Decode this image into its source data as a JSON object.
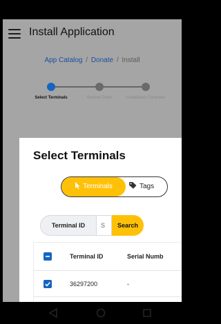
{
  "app": {
    "title": "Install Application"
  },
  "breadcrumb": {
    "items": [
      "App Catalog",
      "Donate",
      "Install"
    ],
    "separator": "/"
  },
  "stepper": {
    "steps": [
      {
        "label": "Select Terminals",
        "state": "active"
      },
      {
        "label": "Review Order",
        "state": "pending"
      },
      {
        "label": "Installation Complete",
        "state": "pending"
      }
    ]
  },
  "modal": {
    "title": "Select Terminals",
    "toggle": {
      "options": [
        {
          "label": "Terminals",
          "icon": "pointer-icon",
          "selected": true
        },
        {
          "label": "Tags",
          "icon": "tag-icon",
          "selected": false
        }
      ]
    },
    "search": {
      "field_label": "Terminal ID",
      "input_value": "S",
      "button_label": "Search"
    },
    "table": {
      "columns": [
        "Terminal ID",
        "Serial Numb"
      ],
      "rows": [
        {
          "terminal_id": "36297200",
          "serial_number": "-",
          "checked": true
        }
      ],
      "header_checkbox": "indeterminate"
    }
  },
  "colors": {
    "accent": "#ffc107",
    "primary": "#1565c0",
    "link": "#1b4fa0",
    "overlay": "#a5a5a5"
  }
}
